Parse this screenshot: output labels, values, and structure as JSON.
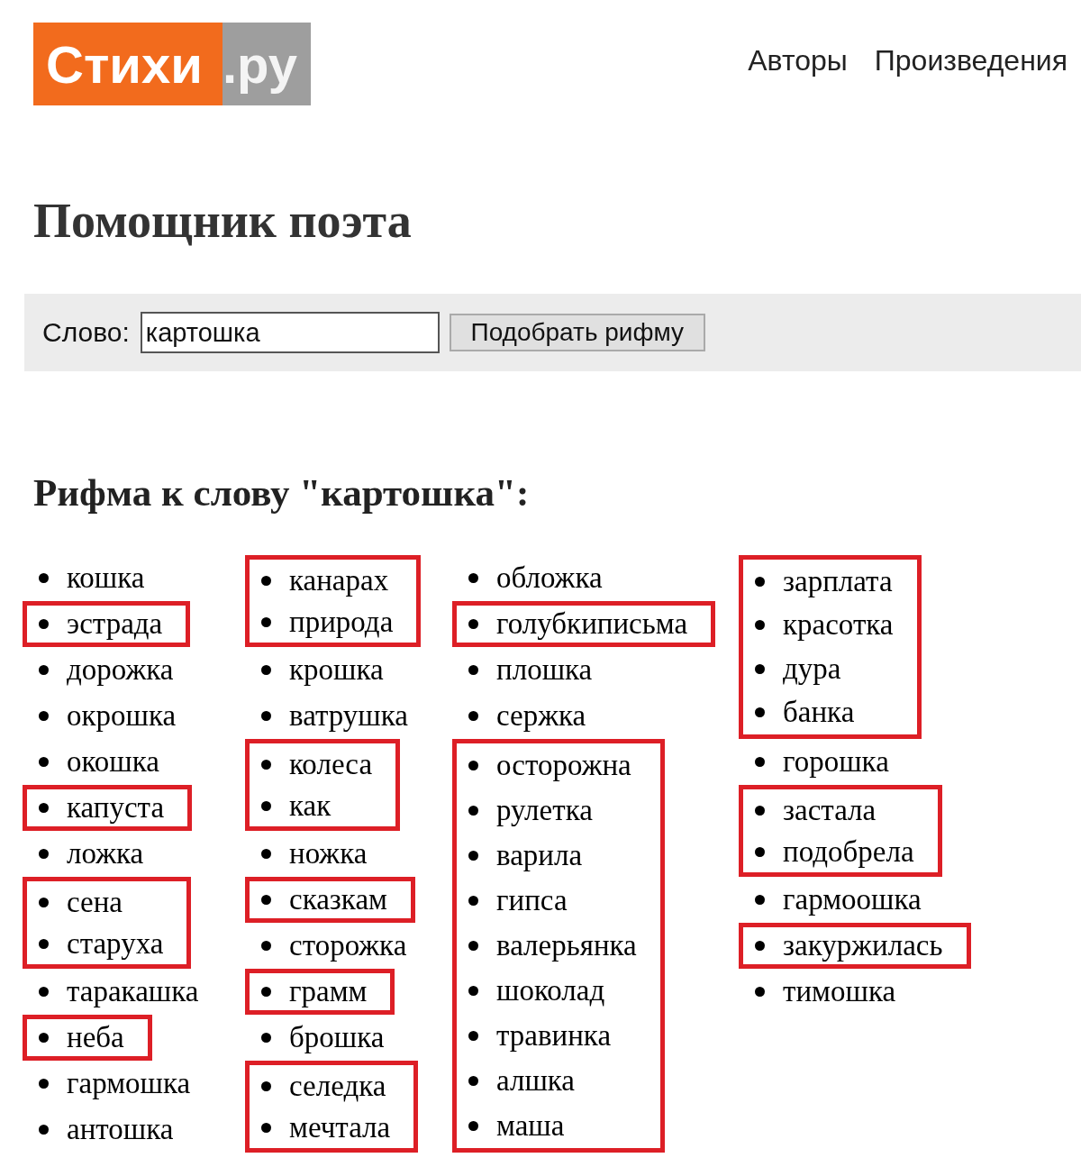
{
  "header": {
    "logo": {
      "primary": "Стихи",
      "secondary": ".ру"
    },
    "nav": [
      "Авторы",
      "Произведения"
    ]
  },
  "title": "Помощник поэта",
  "search": {
    "label": "Слово:",
    "value": "картошка",
    "button": "Подобрать рифму"
  },
  "rhymes": {
    "heading": "Рифма к слову \"картошка\":",
    "columns": [
      {
        "groups": [
          {
            "boxed": false,
            "words": [
              "кошка"
            ]
          },
          {
            "boxed": true,
            "words": [
              "эстрада"
            ]
          },
          {
            "boxed": false,
            "words": [
              "дорожка",
              "окрошка",
              "окошка"
            ]
          },
          {
            "boxed": true,
            "words": [
              "капуста"
            ]
          },
          {
            "boxed": false,
            "words": [
              "ложка"
            ]
          },
          {
            "boxed": true,
            "words": [
              "сена",
              "старуха"
            ]
          },
          {
            "boxed": false,
            "words": [
              "таракашка"
            ]
          },
          {
            "boxed": true,
            "words": [
              "неба"
            ]
          },
          {
            "boxed": false,
            "words": [
              "гармошка",
              "антошка"
            ]
          }
        ]
      },
      {
        "groups": [
          {
            "boxed": true,
            "words": [
              "канарах",
              "природа"
            ]
          },
          {
            "boxed": false,
            "words": [
              "крошка",
              "ватрушка"
            ]
          },
          {
            "boxed": true,
            "words": [
              "колеса",
              "как"
            ]
          },
          {
            "boxed": false,
            "words": [
              "ножка"
            ]
          },
          {
            "boxed": true,
            "words": [
              "сказкам"
            ]
          },
          {
            "boxed": false,
            "words": [
              "сторожка"
            ]
          },
          {
            "boxed": true,
            "words": [
              "грамм"
            ]
          },
          {
            "boxed": false,
            "words": [
              "брошка"
            ]
          },
          {
            "boxed": true,
            "words": [
              "селедка",
              "мечтала"
            ]
          }
        ]
      },
      {
        "groups": [
          {
            "boxed": false,
            "words": [
              "обложка"
            ]
          },
          {
            "boxed": true,
            "words": [
              "голубкиписьма"
            ]
          },
          {
            "boxed": false,
            "words": [
              "плошка",
              "сержка"
            ]
          },
          {
            "boxed": true,
            "words": [
              "осторожна",
              "рулетка",
              "варила",
              "гипса",
              "валерьянка",
              "шоколад",
              "травинка",
              "алшка",
              "маша"
            ]
          }
        ]
      },
      {
        "groups": [
          {
            "boxed": true,
            "words": [
              "зарплата",
              "красотка",
              "дура",
              "банка"
            ]
          },
          {
            "boxed": false,
            "words": [
              "горошка"
            ]
          },
          {
            "boxed": true,
            "words": [
              "застала",
              "подобрела"
            ]
          },
          {
            "boxed": false,
            "words": [
              "гармоошка"
            ]
          },
          {
            "boxed": true,
            "words": [
              "закуржилась"
            ]
          },
          {
            "boxed": false,
            "words": [
              "тимошка"
            ]
          }
        ]
      }
    ]
  }
}
